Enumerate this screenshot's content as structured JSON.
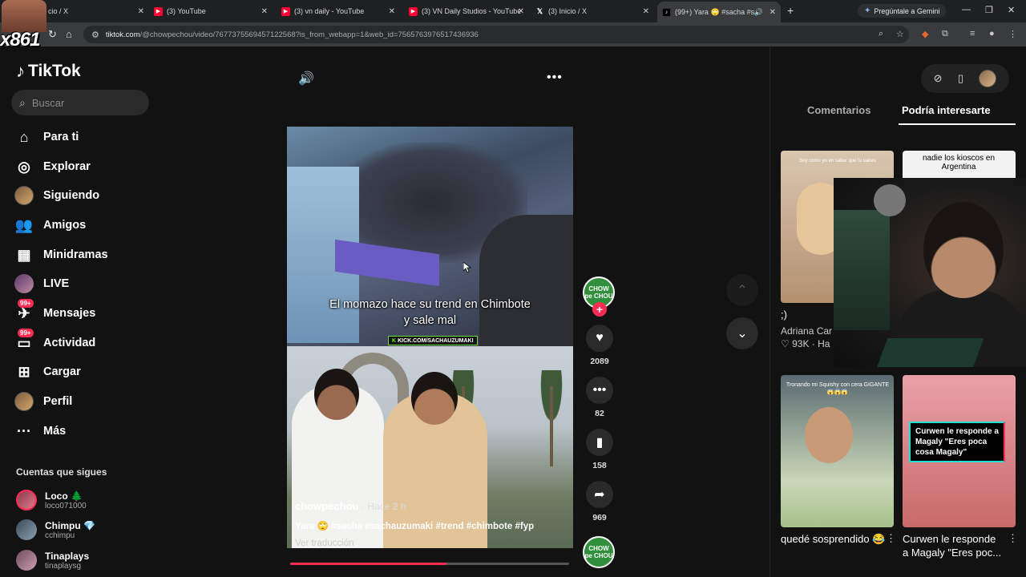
{
  "browser": {
    "tabs": [
      {
        "title": "cio / X",
        "icon": "x-icon"
      },
      {
        "title": "(3) YouTube",
        "icon": "youtube-icon"
      },
      {
        "title": "(3) vn daily - YouTube",
        "icon": "youtube-icon"
      },
      {
        "title": "(3) VN Daily Studios - YouTube",
        "icon": "youtube-icon"
      },
      {
        "title": "(3) Inicio / X",
        "icon": "x-icon"
      },
      {
        "title": "(99+) Yara 🙄 #sacha #sach",
        "icon": "tiktok-icon",
        "active": true
      }
    ],
    "gemini_label": "Pregúntale a Gemini",
    "url_host": "tiktok.com",
    "url_path": "/@chowpechou/video/7677375569457122568?is_from_webapp=1&web_id=7565763976517436936"
  },
  "stream_overlay": {
    "label": "x861"
  },
  "tiktok": {
    "logo": "TikTok",
    "search_placeholder": "Buscar",
    "nav": [
      {
        "label": "Para ti",
        "icon": "home-icon"
      },
      {
        "label": "Explorar",
        "icon": "compass-icon"
      },
      {
        "label": "Siguiendo",
        "icon": "following-avatar-icon"
      },
      {
        "label": "Amigos",
        "icon": "friends-icon"
      },
      {
        "label": "Minidramas",
        "icon": "film-icon"
      },
      {
        "label": "LIVE",
        "icon": "live-avatar-icon"
      },
      {
        "label": "Mensajes",
        "icon": "messages-icon",
        "badge": "99+"
      },
      {
        "label": "Actividad",
        "icon": "activity-icon",
        "badge": "99+"
      },
      {
        "label": "Cargar",
        "icon": "upload-icon"
      },
      {
        "label": "Perfil",
        "icon": "profile-avatar-icon"
      },
      {
        "label": "Más",
        "icon": "more-icon"
      }
    ],
    "following_title": "Cuentas que sigues",
    "following": [
      {
        "name": "Loco 🌲",
        "handle": "loco071000"
      },
      {
        "name": "Chimpu 💎",
        "handle": "cchimpu"
      },
      {
        "name": "Tinaplays",
        "handle": "tinaplaysg"
      }
    ]
  },
  "video": {
    "caption_line1": "El momazo hace su trend en Chimbote",
    "caption_line2": "y sale mal",
    "watermark": "KICK.COM/SACHAUZUMAKI",
    "author": "chowpechou",
    "posted": "· Hace 2 h",
    "description": "Yara 🙄 #sacha #sachauzumaki #trend #chimbote #fyp",
    "translate": "Ver traducción",
    "progress": 0.56,
    "creator_badge": "CHOW pe CHOU",
    "likes": "2089",
    "comments": "82",
    "saves": "158",
    "shares": "969"
  },
  "right_panel": {
    "tab_comments": "Comentarios",
    "tab_recommended": "Podría interesarte",
    "cards": [
      {
        "title": ";)",
        "author": "Adriana Car",
        "likes": "93K",
        "extra": "Ha",
        "overlay_text": "Soy como yo en saber que tu sabes"
      },
      {
        "title": "",
        "overlay_text": "nadie los kioscos en Argentina"
      },
      {
        "title": "quedé sosprendido 😂",
        "overlay_text": "Tronando mi Squishy con cera GIGANTE 😱😱😱"
      },
      {
        "title": "Curwen le responde a Magaly \"Eres poc...",
        "overlay_text": "Curwen le responde a Magaly \"Eres poca cosa Magaly\""
      }
    ]
  },
  "colors": {
    "accent": "#fe2c55",
    "bg": "#121212",
    "kick_green": "#53fc18"
  }
}
